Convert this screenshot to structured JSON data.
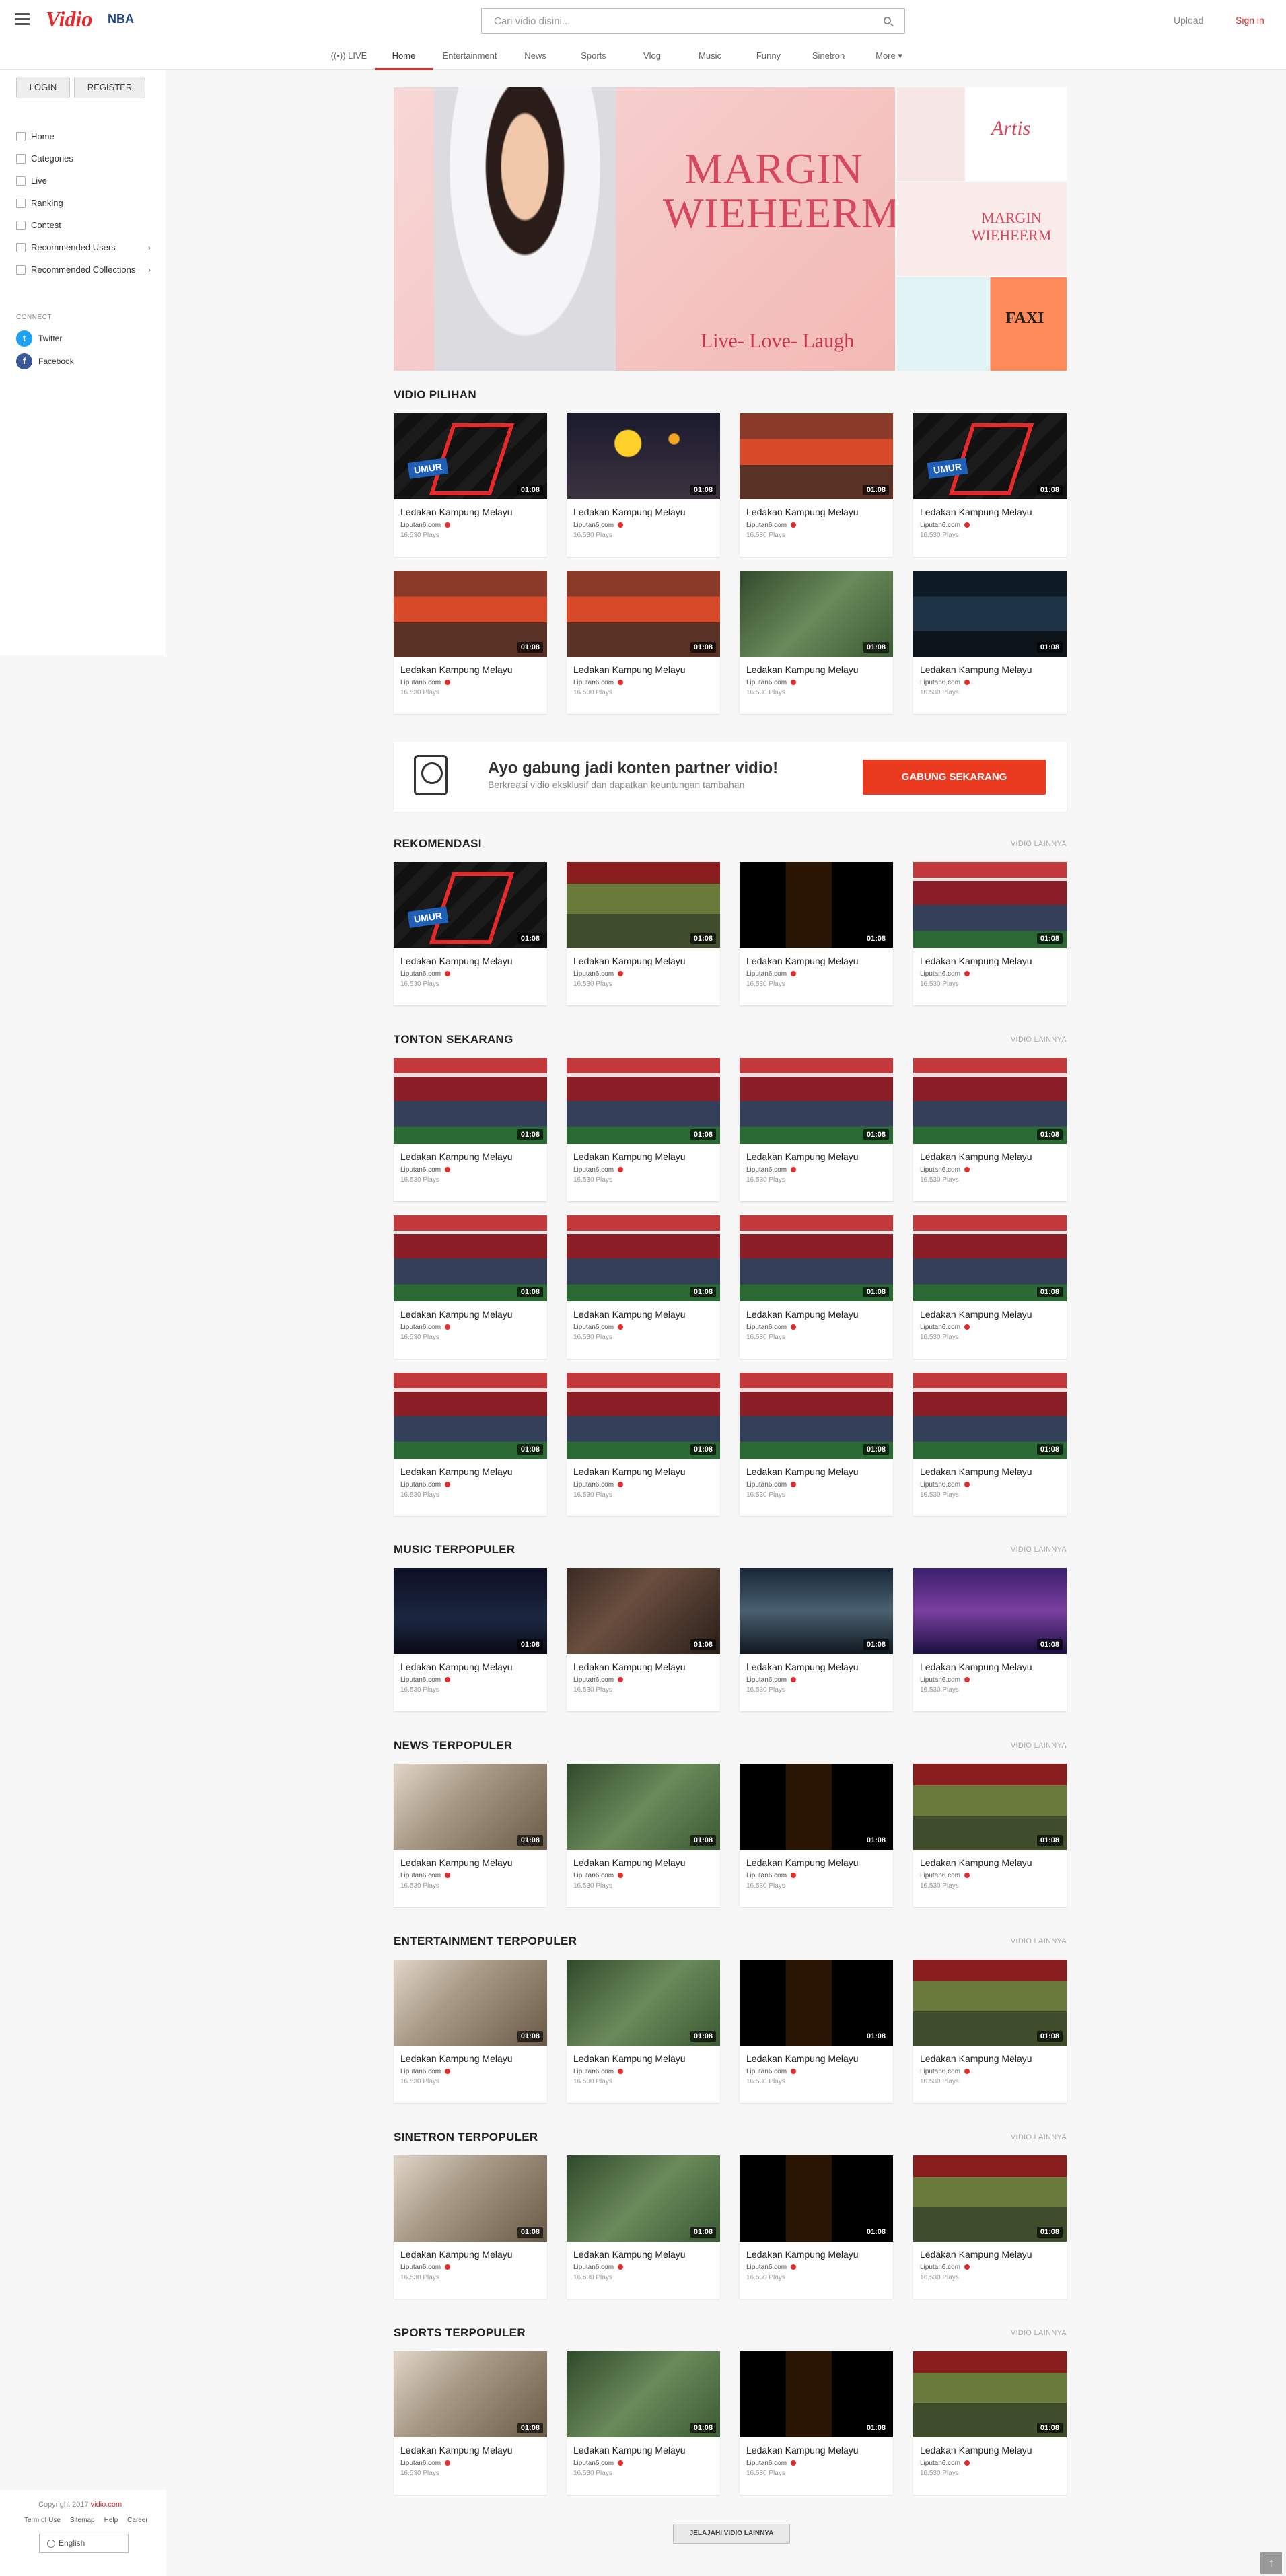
{
  "header": {
    "logo": "Vidio",
    "partner": "NBA",
    "search_placeholder": "Cari vidio disini...",
    "upload": "Upload",
    "signin": "Sign in"
  },
  "nav": [
    {
      "label": "((•)) LIVE"
    },
    {
      "label": "Home",
      "active": true
    },
    {
      "label": "Entertainment"
    },
    {
      "label": "News"
    },
    {
      "label": "Sports"
    },
    {
      "label": "Vlog"
    },
    {
      "label": "Music"
    },
    {
      "label": "Funny"
    },
    {
      "label": "Sinetron"
    },
    {
      "label": "More ▾"
    }
  ],
  "sidebar": {
    "login": "LOGIN",
    "register": "REGISTER",
    "items": [
      {
        "label": "Home"
      },
      {
        "label": "Categories"
      },
      {
        "label": "Live"
      },
      {
        "label": "Ranking"
      },
      {
        "label": "Contest"
      },
      {
        "label": "Recommended Users"
      },
      {
        "label": "Recommended Collections"
      }
    ],
    "connect": "CONNECT",
    "twitter": "Twitter",
    "facebook": "Facebook"
  },
  "hero": {
    "title_line1": "MARGIN",
    "title_line2": "WIEHEERM",
    "subtitle": "Live- Love- Laugh",
    "side1": "Artis",
    "side2": "MARGIN WIEHEERM",
    "side3": "FAXI"
  },
  "card": {
    "title": "Ledakan Kampung Melayu",
    "source": "Liputan6.com",
    "plays": "16.530 Plays",
    "duration": "01:08"
  },
  "sections": {
    "pilihan": "VIDIO PILIHAN",
    "rekomendasi": "REKOMENDASI",
    "tonton": "TONTON SEKARANG",
    "music": "MUSIC TERPOPULER",
    "news": "NEWS TERPOPULER",
    "entertainment": "ENTERTAINMENT TERPOPULER",
    "sinetron": "SINETRON TERPOPULER",
    "sports": "SPORTS TERPOPULER",
    "more": "VIDIO LAINNYA"
  },
  "banner": {
    "title": "Ayo gabung jadi konten partner vidio!",
    "subtitle": "Berkreasi vidio eksklusif dan dapatkan keuntungan tambahan",
    "cta": "GABUNG SEKARANG"
  },
  "explore_button": "JELAJAHI VIDIO LAINNYA",
  "footer": {
    "copyright": "Copyright 2017",
    "site": "vidio.com",
    "links": [
      "Term of Use",
      "Sitemap",
      "Help",
      "Career"
    ],
    "language": "English"
  }
}
